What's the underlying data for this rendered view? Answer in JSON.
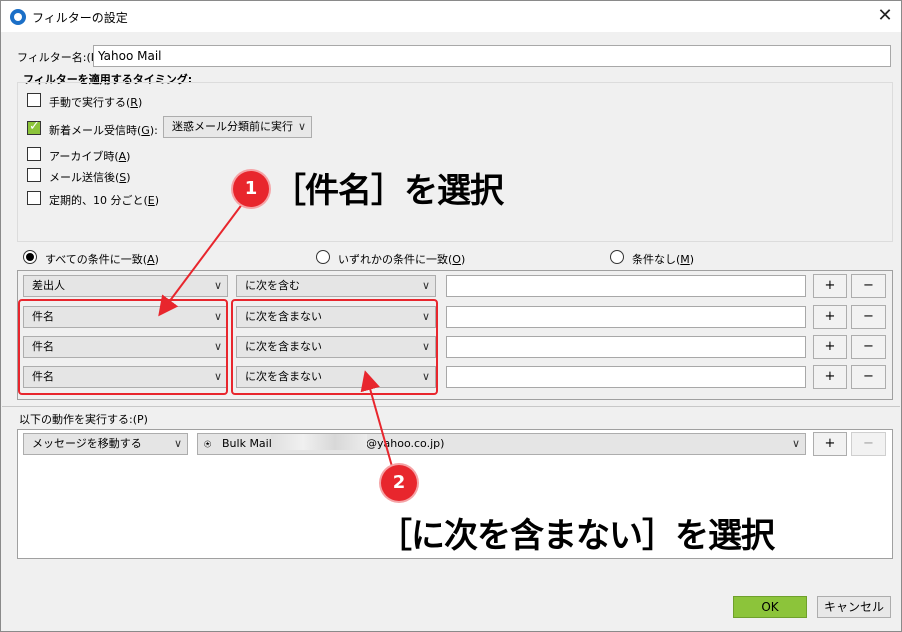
{
  "window": {
    "title": "フィルターの設定"
  },
  "filter_name": {
    "label": "フィルター名:(I)",
    "value": "Yahoo Mail"
  },
  "timing": {
    "heading": "フィルターを適用するタイミング:",
    "manual": {
      "label": "手動で実行する(",
      "key": "R",
      "end": ")",
      "checked": false
    },
    "new_mail": {
      "label": "新着メール受信時(",
      "key": "G",
      "end": "):",
      "checked": true
    },
    "new_mail_select": "迷惑メール分類前に実行",
    "archive": {
      "label": "アーカイブ時(",
      "key": "A",
      "end": ")",
      "checked": false
    },
    "after_send": {
      "label": "メール送信後(",
      "key": "S",
      "end": ")",
      "checked": false
    },
    "periodic": {
      "label": "定期的、10 分ごと(",
      "key": "E",
      "end": ")",
      "checked": false
    }
  },
  "match": {
    "all": {
      "label": "すべての条件に一致(",
      "key": "A",
      "end": ")",
      "selected": true
    },
    "any": {
      "label": "いずれかの条件に一致(",
      "key": "O",
      "end": ")",
      "selected": false
    },
    "none": {
      "label": "条件なし(",
      "key": "M",
      "end": ")",
      "selected": false
    }
  },
  "rules": [
    {
      "field": "差出人",
      "op": "に次を含む",
      "value": ""
    },
    {
      "field": "件名",
      "op": "に次を含まない",
      "value": ""
    },
    {
      "field": "件名",
      "op": "に次を含まない",
      "value": ""
    },
    {
      "field": "件名",
      "op": "に次を含まない",
      "value": ""
    }
  ],
  "buttons": {
    "add": "+",
    "remove": "−",
    "ok": "OK",
    "cancel": "キャンセル"
  },
  "actions": {
    "heading": "以下の動作を実行する:(P)",
    "action_select": "メッセージを移動する",
    "folder_name": "Bulk Mail",
    "folder_account": "@yahoo.co.jp)"
  },
  "annotations": {
    "step1_number": "1",
    "step1_text": "［件名］を選択",
    "step2_number": "2",
    "step2_text": "［に次を含まない］を選択"
  },
  "colors": {
    "accent_green": "#8cc43a",
    "annotation_red": "#e8262d"
  }
}
